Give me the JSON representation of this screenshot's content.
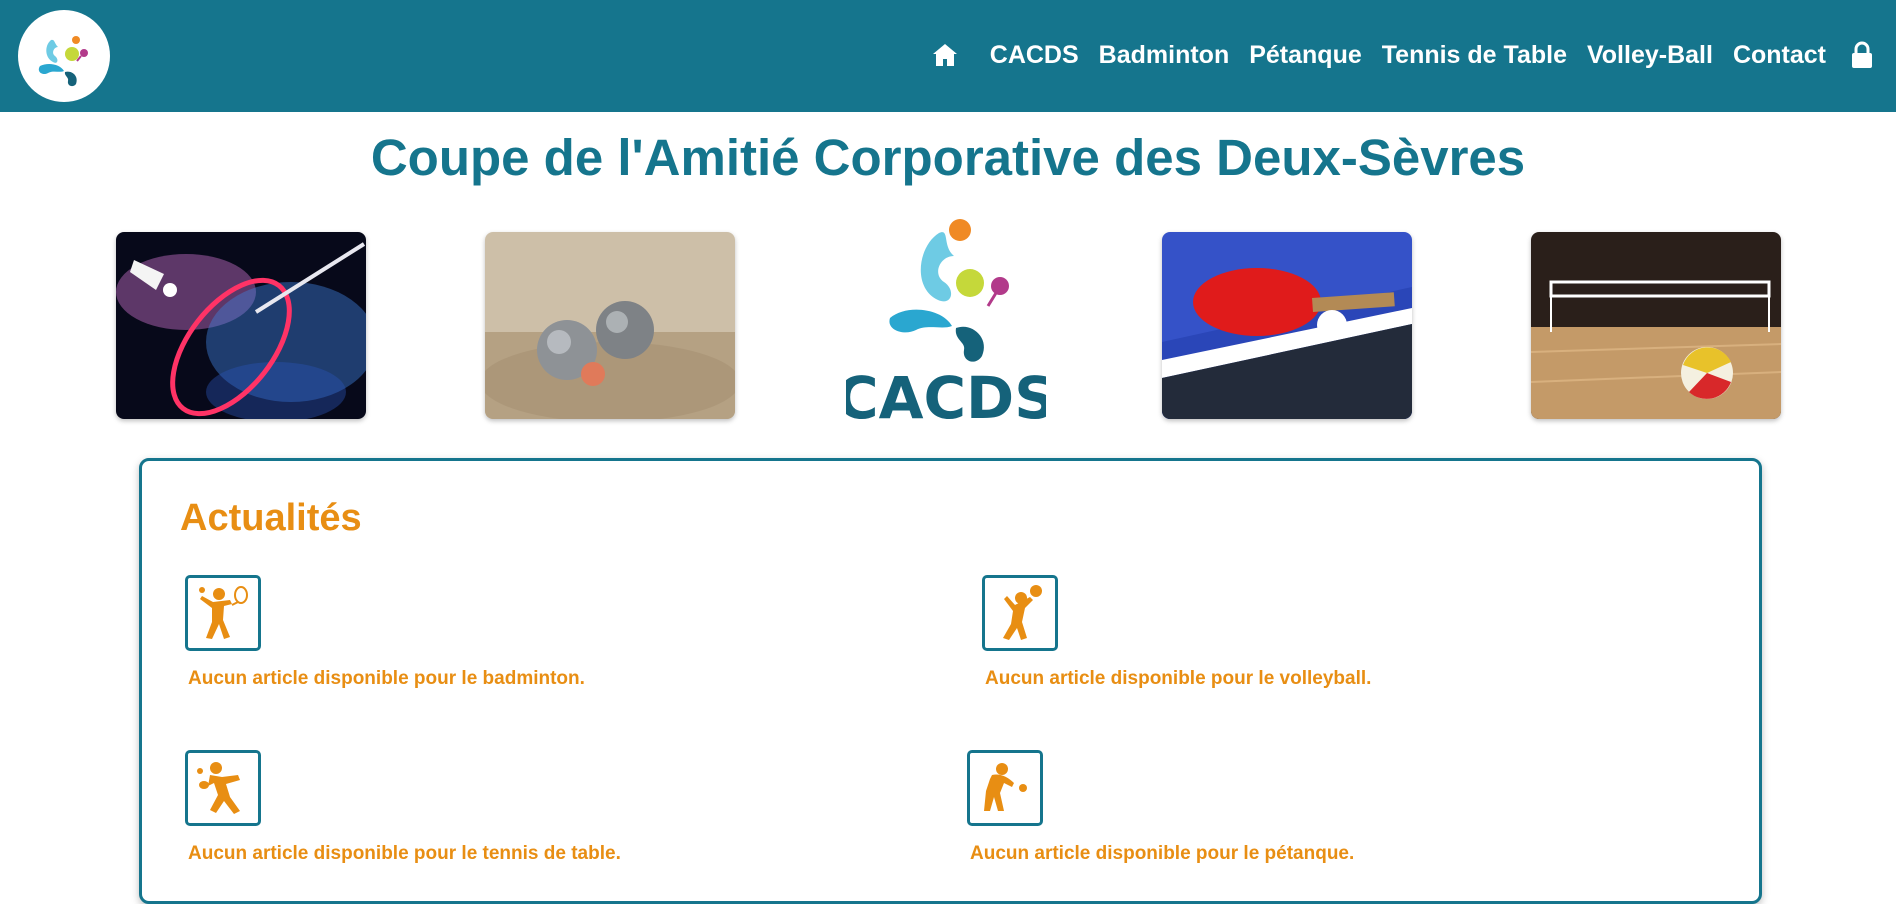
{
  "header": {
    "logo_icon": "cacds-logo",
    "nav": {
      "home_icon": "home-icon",
      "items": [
        "CACDS",
        "Badminton",
        "Pétanque",
        "Tennis de Table",
        "Volley-Ball",
        "Contact"
      ],
      "lock_icon": "lock-icon"
    }
  },
  "banner": {
    "title": "Coupe de l'Amitié Corporative des Deux-Sèvres",
    "images": [
      "badminton-photo",
      "petanque-photo",
      "cacds-logo",
      "table-tennis-photo",
      "volleyball-photo"
    ],
    "logo_text": "CACDS"
  },
  "news": {
    "heading": "Actualités",
    "items": [
      {
        "icon": "badminton-player-icon",
        "text": "Aucun article disponible pour le badminton."
      },
      {
        "icon": "volleyball-player-icon",
        "text": "Aucun article disponible pour le volleyball."
      },
      {
        "icon": "table-tennis-player-icon",
        "text": "Aucun article disponible pour le tennis de table."
      },
      {
        "icon": "petanque-player-icon",
        "text": "Aucun article disponible pour le pétanque."
      }
    ]
  },
  "colors": {
    "primary": "#15758d",
    "accent": "#e88e13",
    "background": "#ffffff"
  }
}
